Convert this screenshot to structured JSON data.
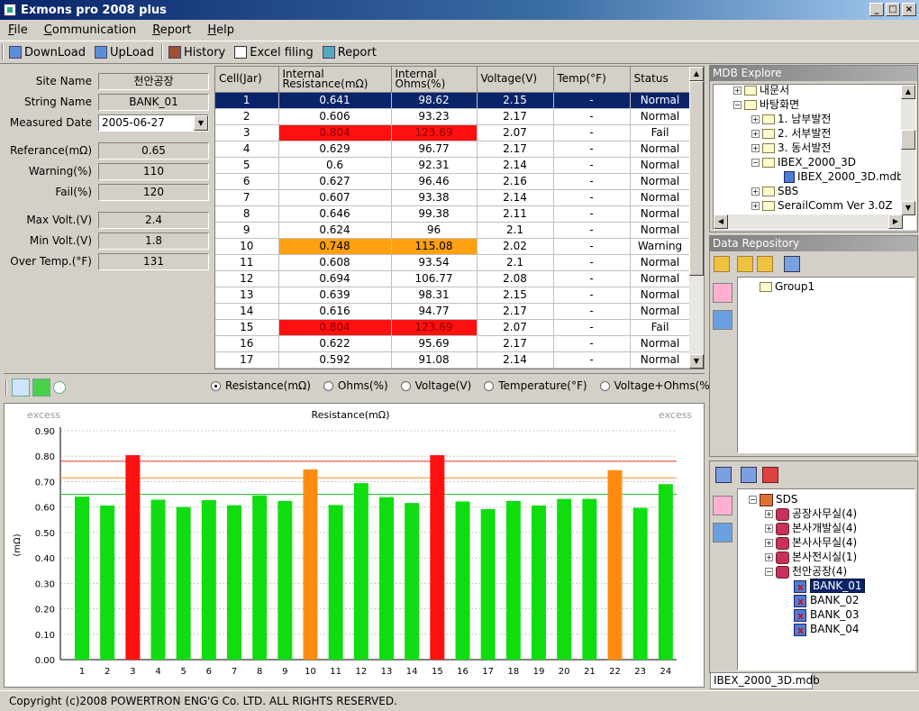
{
  "app": {
    "title": "Exmons pro 2008 plus"
  },
  "menu": [
    "File",
    "Communication",
    "Report",
    "Help"
  ],
  "toolbar": {
    "download": "DownLoad",
    "upload": "UpLoad",
    "history": "History",
    "excel": "Excel filing",
    "report": "Report"
  },
  "info": {
    "site_label": "Site Name",
    "site_value": "천안공장",
    "string_label": "String Name",
    "string_value": "BANK_01",
    "date_label": "Measured Date",
    "date_value": "2005-06-27",
    "ref_label": "Referance(mΩ)",
    "ref_value": "0.65",
    "warn_label": "Warning(%)",
    "warn_value": "110",
    "fail_label": "Fail(%)",
    "fail_value": "120",
    "maxv_label": "Max Volt.(V)",
    "maxv_value": "2.4",
    "minv_label": "Min Volt.(V)",
    "minv_value": "1.8",
    "temp_label": "Over Temp.(°F)",
    "temp_value": "131"
  },
  "grid": {
    "headers": [
      "Cell(Jar)",
      "Internal Resistance(mΩ)",
      "Internal Ohms(%)",
      "Voltage(V)",
      "Temp(°F)",
      "Status"
    ],
    "rows": [
      [
        "1",
        "0.641",
        "98.62",
        "2.15",
        "-",
        "Normal"
      ],
      [
        "2",
        "0.606",
        "93.23",
        "2.17",
        "-",
        "Normal"
      ],
      [
        "3",
        "0.804",
        "123.69",
        "2.07",
        "-",
        "Fail"
      ],
      [
        "4",
        "0.629",
        "96.77",
        "2.17",
        "-",
        "Normal"
      ],
      [
        "5",
        "0.6",
        "92.31",
        "2.14",
        "-",
        "Normal"
      ],
      [
        "6",
        "0.627",
        "96.46",
        "2.16",
        "-",
        "Normal"
      ],
      [
        "7",
        "0.607",
        "93.38",
        "2.14",
        "-",
        "Normal"
      ],
      [
        "8",
        "0.646",
        "99.38",
        "2.11",
        "-",
        "Normal"
      ],
      [
        "9",
        "0.624",
        "96",
        "2.1",
        "-",
        "Normal"
      ],
      [
        "10",
        "0.748",
        "115.08",
        "2.02",
        "-",
        "Warning"
      ],
      [
        "11",
        "0.608",
        "93.54",
        "2.1",
        "-",
        "Normal"
      ],
      [
        "12",
        "0.694",
        "106.77",
        "2.08",
        "-",
        "Normal"
      ],
      [
        "13",
        "0.639",
        "98.31",
        "2.15",
        "-",
        "Normal"
      ],
      [
        "14",
        "0.616",
        "94.77",
        "2.17",
        "-",
        "Normal"
      ],
      [
        "15",
        "0.804",
        "123.69",
        "2.07",
        "-",
        "Fail"
      ],
      [
        "16",
        "0.622",
        "95.69",
        "2.17",
        "-",
        "Normal"
      ],
      [
        "17",
        "0.592",
        "91.08",
        "2.14",
        "-",
        "Normal"
      ]
    ]
  },
  "radios": [
    "Resistance(mΩ)",
    "Ohms(%)",
    "Voltage(V)",
    "Temperature(°F)",
    "Voltage+Ohms(%)"
  ],
  "chart_data": {
    "type": "bar",
    "title": "Resistance(mΩ)",
    "ylabel": "(mΩ)",
    "xlabel": "",
    "excess_left": "excess",
    "excess_right": "excess",
    "ylim": [
      0,
      0.9
    ],
    "yticks": [
      "0.00",
      "0.10",
      "0.20",
      "0.30",
      "0.40",
      "0.50",
      "0.60",
      "0.70",
      "0.80",
      "0.90"
    ],
    "categories": [
      "1",
      "2",
      "3",
      "4",
      "5",
      "6",
      "7",
      "8",
      "9",
      "10",
      "11",
      "12",
      "13",
      "14",
      "15",
      "16",
      "17",
      "18",
      "19",
      "20",
      "21",
      "22",
      "23",
      "24"
    ],
    "values": [
      0.641,
      0.606,
      0.804,
      0.629,
      0.6,
      0.627,
      0.607,
      0.646,
      0.624,
      0.748,
      0.608,
      0.694,
      0.639,
      0.616,
      0.804,
      0.622,
      0.592,
      0.624,
      0.606,
      0.632,
      0.632,
      0.745,
      0.597,
      0.69
    ],
    "status": [
      "Normal",
      "Normal",
      "Fail",
      "Normal",
      "Normal",
      "Normal",
      "Normal",
      "Normal",
      "Normal",
      "Warning",
      "Normal",
      "Normal",
      "Normal",
      "Normal",
      "Fail",
      "Normal",
      "Normal",
      "Normal",
      "Normal",
      "Normal",
      "Normal",
      "Warning",
      "Normal",
      "Normal"
    ],
    "reference_line": 0.65,
    "warning_line": 0.715,
    "fail_line": 0.78,
    "colors": {
      "normal": "#10dd10",
      "warning": "#ff8c10",
      "fail": "#ff1010"
    },
    "grid": true
  },
  "mdb": {
    "title": "MDB Explore",
    "items": [
      "내문서",
      "바탕화면",
      "1. 남부발전",
      "2. 서부발전",
      "3. 동서발전",
      "IBEX_2000_3D",
      "IBEX_2000_3D.mdb",
      "SBS",
      "SerailComm Ver 3.0Z"
    ]
  },
  "repo": {
    "title": "Data Repository",
    "group": "Group1"
  },
  "sds": {
    "root": "SDS",
    "sites": [
      "공장사무실(4)",
      "본사개발실(4)",
      "본사사무실(4)",
      "본사전시실(1)",
      "천안공장(4)"
    ],
    "banks": [
      "BANK_01",
      "BANK_02",
      "BANK_03",
      "BANK_04"
    ]
  },
  "tab": "IBEX_2000_3D.mdb",
  "status": "Copyright (c)2008 POWERTRON ENG'G Co. LTD. ALL RIGHTS RESERVED."
}
